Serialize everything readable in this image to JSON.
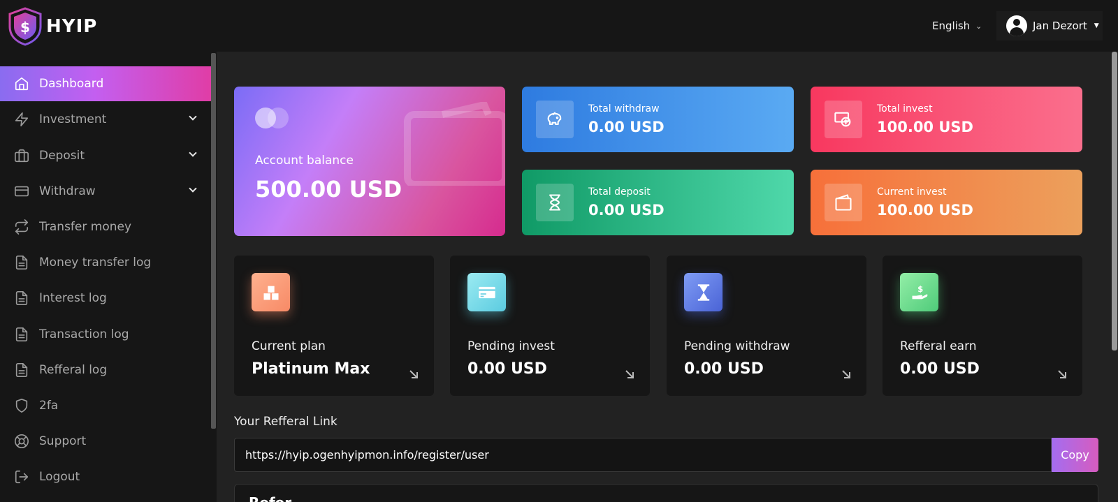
{
  "brand": {
    "name": "HYIP"
  },
  "header": {
    "language": "English",
    "user_name": "Jan Dezort"
  },
  "sidebar": {
    "items": [
      {
        "label": "Dashboard",
        "icon": "home-icon",
        "active": true
      },
      {
        "label": "Investment",
        "icon": "bolt-icon",
        "has_submenu": true
      },
      {
        "label": "Deposit",
        "icon": "briefcase-icon",
        "has_submenu": true
      },
      {
        "label": "Withdraw",
        "icon": "credit-card-icon",
        "has_submenu": true
      },
      {
        "label": "Transfer money",
        "icon": "repeat-icon"
      },
      {
        "label": "Money transfer log",
        "icon": "file-text-icon"
      },
      {
        "label": "Interest log",
        "icon": "file-text-icon"
      },
      {
        "label": "Transaction log",
        "icon": "file-text-icon"
      },
      {
        "label": "Refferal log",
        "icon": "file-text-icon"
      },
      {
        "label": "2fa",
        "icon": "shield-icon"
      },
      {
        "label": "Support",
        "icon": "life-buoy-icon"
      },
      {
        "label": "Logout",
        "icon": "log-out-icon"
      }
    ]
  },
  "balance": {
    "label": "Account balance",
    "value": "500.00 USD"
  },
  "stats": {
    "total_withdraw": {
      "label": "Total withdraw",
      "value": "0.00 USD",
      "icon": "piggy-bank-icon",
      "colors": [
        "#2e7be0",
        "#5aaaf3"
      ]
    },
    "total_invest": {
      "label": "Total invest",
      "value": "100.00 USD",
      "icon": "money-icon",
      "colors": [
        "#f8385f",
        "#fa6f8d"
      ]
    },
    "total_deposit": {
      "label": "Total deposit",
      "value": "0.00 USD",
      "icon": "hourglass-icon",
      "colors": [
        "#109a66",
        "#4fd8aa"
      ]
    },
    "current_invest": {
      "label": "Current invest",
      "value": "100.00 USD",
      "icon": "wallet-icon",
      "colors": [
        "#f7703a",
        "#eca05c"
      ]
    }
  },
  "mini_cards": {
    "current_plan": {
      "label": "Current plan",
      "value": "Platinum Max",
      "icon": "boxes-icon"
    },
    "pending_invest": {
      "label": "Pending invest",
      "value": "0.00 USD",
      "icon": "card-icon"
    },
    "pending_withdraw": {
      "label": "Pending withdraw",
      "value": "0.00 USD",
      "icon": "hourglass-icon"
    },
    "refferal_earn": {
      "label": "Refferal earn",
      "value": "0.00 USD",
      "icon": "hand-dollar-icon"
    }
  },
  "referral": {
    "title": "Your Refferal Link",
    "link": "https://hyip.ogenhyipmon.info/register/user",
    "copy_label": "Copy"
  },
  "bottom_panel": {
    "title": "Refer…"
  }
}
